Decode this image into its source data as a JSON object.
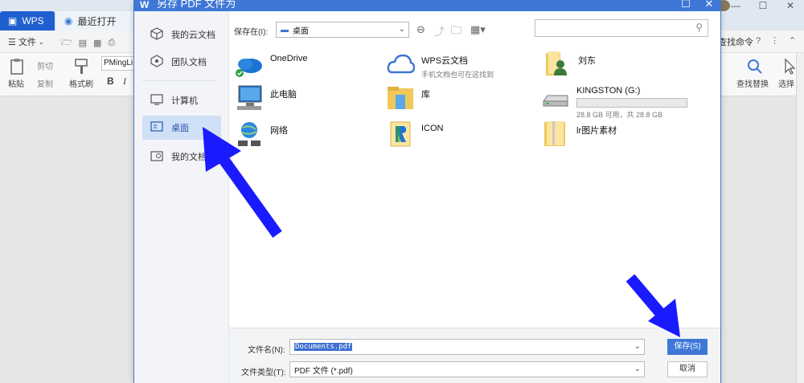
{
  "app": {
    "tabs": [
      {
        "label": "WPS"
      },
      {
        "label": "最近打开"
      }
    ],
    "menu": {
      "file_label": "文件",
      "find_cmd": "查找命令"
    },
    "ribbon": {
      "paste": "粘贴",
      "cut": "剪切",
      "copy": "复制",
      "format_painter": "格式刷",
      "font_name": "PMingLi",
      "bold": "B",
      "italic": "I",
      "find_replace": "查找替换",
      "select": "选择"
    }
  },
  "dialog": {
    "title": "另存 PDF 文件为",
    "sidebar": [
      {
        "label": "我的云文档",
        "icon": "cube-icon"
      },
      {
        "label": "团队文档",
        "icon": "team-icon"
      },
      {
        "label": "计算机",
        "icon": "monitor-icon"
      },
      {
        "label": "桌面",
        "icon": "desktop-icon",
        "active": true
      },
      {
        "label": "我的文档",
        "icon": "my-docs-icon"
      }
    ],
    "save_in_label": "保存在(I):",
    "save_in_value": "桌面",
    "items": [
      {
        "name": "OneDrive",
        "sub": "",
        "icon": "onedrive-icon"
      },
      {
        "name": "WPS云文档",
        "sub": "手机文档也可在这找到",
        "icon": "wps-cloud-icon"
      },
      {
        "name": "刘东",
        "sub": "",
        "icon": "user-folder-icon"
      },
      {
        "name": "此电脑",
        "sub": "",
        "icon": "pc-icon"
      },
      {
        "name": "库",
        "sub": "",
        "icon": "library-icon"
      },
      {
        "name": "KINGSTON (G:)",
        "sub": "28.8 GB 可用，共 28.8 GB",
        "icon": "usb-drive-icon",
        "used_fraction": 0.0
      },
      {
        "name": "网络",
        "sub": "",
        "icon": "network-icon"
      },
      {
        "name": "ICON",
        "sub": "",
        "icon": "icon-folder-icon"
      },
      {
        "name": "lr图片素材",
        "sub": "",
        "icon": "folder-icon"
      }
    ],
    "filename_label": "文件名(N):",
    "filename_value": "Documents.pdf",
    "filetype_label": "文件类型(T):",
    "filetype_value": "PDF 文件 (*.pdf)",
    "save_button": "保存(S)",
    "cancel_button": "取消"
  },
  "colors": {
    "accent": "#3e77d6",
    "annotation_arrow": "#1a1aff",
    "sidebar_active": "#cfe0f7"
  }
}
